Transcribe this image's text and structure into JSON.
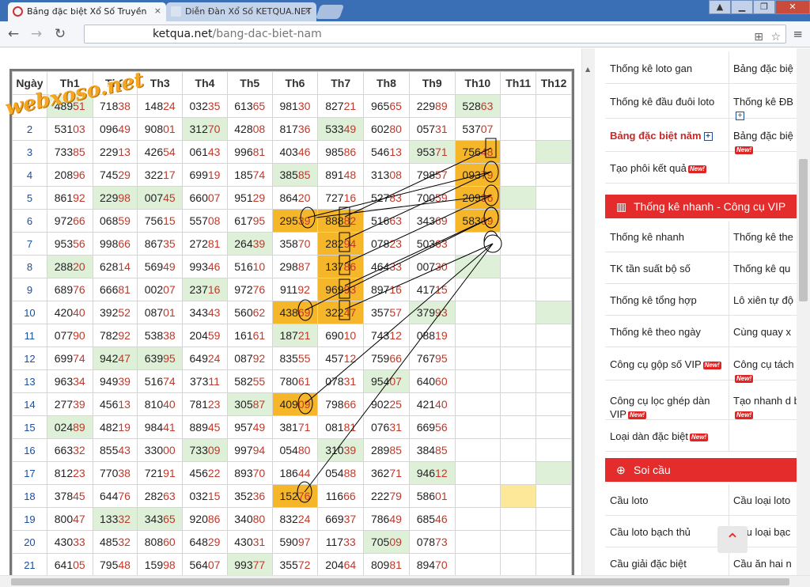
{
  "browser": {
    "tabs": [
      {
        "title": "Bảng đặc biệt Xổ Số Truyền",
        "active": true
      },
      {
        "title": "Diễn Đàn Xổ Số KETQUA.NET",
        "active": false
      }
    ],
    "url_host": "ketqua.net",
    "url_path": "/bang-dac-biet-nam",
    "close_glyph": "×"
  },
  "watermark": "webxoso.net",
  "table": {
    "headers": [
      "Ngày",
      "Th1",
      "Th2",
      "Th3",
      "Th4",
      "Th5",
      "Th6",
      "Th7",
      "Th8",
      "Th9",
      "Th10",
      "Th11",
      "Th12"
    ],
    "rows": [
      {
        "day": "1",
        "cells": [
          "48951",
          "71838",
          "14824",
          "03235",
          "61365",
          "98130",
          "82721",
          "96565",
          "22989",
          "52863",
          "",
          ""
        ],
        "hl": {
          "0": "g",
          "9": "g"
        }
      },
      {
        "day": "2",
        "cells": [
          "53103",
          "09649",
          "90801",
          "31270",
          "42808",
          "81736",
          "53349",
          "60280",
          "05731",
          "53707",
          "",
          ""
        ],
        "hl": {
          "3": "g",
          "6": "g"
        }
      },
      {
        "day": "3",
        "cells": [
          "73385",
          "22913",
          "42654",
          "06143",
          "99681",
          "40346",
          "98586",
          "54613",
          "95371",
          "75648",
          "",
          ""
        ],
        "hl": {
          "8": "g",
          "9": "o",
          "11": "g"
        }
      },
      {
        "day": "4",
        "cells": [
          "20896",
          "74529",
          "32217",
          "69919",
          "18574",
          "38585",
          "89148",
          "31308",
          "79857",
          "09379",
          "",
          ""
        ],
        "hl": {
          "5": "g",
          "9": "o"
        }
      },
      {
        "day": "5",
        "cells": [
          "86192",
          "22998",
          "00745",
          "66007",
          "95129",
          "86420",
          "72716",
          "52783",
          "70059",
          "20996",
          "",
          ""
        ],
        "hl": {
          "1": "g",
          "2": "g",
          "9": "o",
          "10": "g"
        }
      },
      {
        "day": "6",
        "cells": [
          "97266",
          "06859",
          "75615",
          "55708",
          "61795",
          "29539",
          "88882",
          "51663",
          "34369",
          "58309",
          "",
          ""
        ],
        "hl": {
          "5": "o",
          "6": "o",
          "9": "o"
        }
      },
      {
        "day": "7",
        "cells": [
          "95356",
          "99866",
          "86735",
          "27281",
          "26439",
          "35870",
          "28294",
          "07823",
          "50363",
          "",
          "",
          ""
        ],
        "hl": {
          "4": "g",
          "6": "o"
        }
      },
      {
        "day": "8",
        "cells": [
          "28820",
          "62814",
          "56949",
          "99346",
          "51610",
          "29887",
          "13786",
          "46433",
          "00730",
          "",
          "",
          ""
        ],
        "hl": {
          "0": "g",
          "6": "o",
          "9": "g"
        }
      },
      {
        "day": "9",
        "cells": [
          "68976",
          "66681",
          "00207",
          "23716",
          "97276",
          "91192",
          "96993",
          "89716",
          "41715",
          "",
          "",
          ""
        ],
        "hl": {
          "3": "g",
          "6": "o"
        }
      },
      {
        "day": "10",
        "cells": [
          "42040",
          "39252",
          "08701",
          "34343",
          "56062",
          "43869",
          "32247",
          "35757",
          "37993",
          "",
          "",
          ""
        ],
        "hl": {
          "5": "o",
          "6": "o",
          "8": "g",
          "11": "g"
        }
      },
      {
        "day": "11",
        "cells": [
          "07790",
          "78292",
          "53838",
          "20459",
          "16161",
          "18721",
          "69010",
          "74312",
          "08819",
          "",
          "",
          ""
        ],
        "hl": {
          "5": "g"
        }
      },
      {
        "day": "12",
        "cells": [
          "69974",
          "94247",
          "63995",
          "64924",
          "08792",
          "83555",
          "45712",
          "75966",
          "76795",
          "",
          "",
          ""
        ],
        "hl": {
          "1": "g",
          "2": "g"
        }
      },
      {
        "day": "13",
        "cells": [
          "96334",
          "94939",
          "51674",
          "37311",
          "58255",
          "78061",
          "07831",
          "95407",
          "64060",
          "",
          "",
          ""
        ],
        "hl": {
          "7": "g"
        }
      },
      {
        "day": "14",
        "cells": [
          "27739",
          "45613",
          "81040",
          "78123",
          "30587",
          "40909",
          "79866",
          "90225",
          "42140",
          "",
          "",
          ""
        ],
        "hl": {
          "4": "g",
          "5": "o"
        }
      },
      {
        "day": "15",
        "cells": [
          "02489",
          "48219",
          "98441",
          "88945",
          "95749",
          "38171",
          "08181",
          "07631",
          "66956",
          "",
          "",
          ""
        ],
        "hl": {
          "0": "g"
        }
      },
      {
        "day": "16",
        "cells": [
          "66332",
          "85543",
          "33000",
          "73309",
          "99794",
          "05480",
          "31039",
          "28985",
          "38485",
          "",
          "",
          ""
        ],
        "hl": {
          "3": "g",
          "6": "g"
        }
      },
      {
        "day": "17",
        "cells": [
          "81223",
          "77038",
          "72191",
          "45622",
          "89370",
          "18644",
          "05488",
          "36271",
          "94612",
          "",
          "",
          ""
        ],
        "hl": {
          "8": "g",
          "11": "g"
        }
      },
      {
        "day": "18",
        "cells": [
          "37845",
          "64476",
          "28263",
          "03215",
          "35236",
          "15276",
          "11666",
          "22279",
          "58601",
          "",
          "",
          ""
        ],
        "hl": {
          "5": "o",
          "10": "y"
        }
      },
      {
        "day": "19",
        "cells": [
          "80047",
          "13332",
          "34365",
          "92086",
          "34080",
          "83224",
          "66937",
          "78649",
          "68546",
          "",
          "",
          ""
        ],
        "hl": {
          "1": "g",
          "2": "g"
        }
      },
      {
        "day": "20",
        "cells": [
          "43033",
          "48532",
          "80860",
          "64829",
          "43031",
          "59097",
          "11733",
          "70509",
          "07873",
          "",
          "",
          ""
        ],
        "hl": {
          "7": "g"
        }
      },
      {
        "day": "21",
        "cells": [
          "64105",
          "79548",
          "15998",
          "56407",
          "99377",
          "35572",
          "20464",
          "80981",
          "89470",
          "",
          "",
          ""
        ],
        "hl": {
          "4": "g"
        }
      }
    ]
  },
  "sidebar": {
    "top_rows": [
      {
        "left": "Thống kê loto gan",
        "right": "Bảng đặc biệ"
      },
      {
        "left": "Thống kê đầu đuôi loto",
        "right": "Thống kê ĐB",
        "right_plus": true
      },
      {
        "left": "Bảng đặc biệt năm",
        "left_plus": true,
        "left_hot": true,
        "right": "Bảng đặc biệ",
        "right_new": true
      },
      {
        "left": "Tạo phôi kết quả",
        "left_new": true,
        "right": ""
      }
    ],
    "section1": {
      "title": "Thống kê nhanh - Công cụ VIP",
      "icon": "bar-chart-icon"
    },
    "section1_rows": [
      {
        "left": "Thống kê nhanh",
        "right": "Thống kê the"
      },
      {
        "left": "TK tần suất bộ số",
        "right": "Thống kê qu"
      },
      {
        "left": "Thống kê tổng hợp",
        "right": "Lô xiên tự độ"
      },
      {
        "left": "Thống kê theo ngày",
        "right": "Cùng quay x"
      },
      {
        "left": "Công cụ gộp số VIP",
        "left_new": true,
        "right": "Công cụ tách",
        "right_new": true
      },
      {
        "left": "Công cụ lọc ghép dàn VIP",
        "left_new": true,
        "right": "Tạo nhanh d biệt",
        "right_new": true
      },
      {
        "left": "Loại dàn đặc biệt",
        "left_new": true,
        "right": ""
      }
    ],
    "section2": {
      "title": "Soi cầu",
      "icon": "search-plus-icon"
    },
    "section2_rows": [
      {
        "left": "Cầu loto",
        "right": "Cầu loại loto"
      },
      {
        "left": "Cầu loto bạch thủ",
        "right": "Cầu loại bạc"
      },
      {
        "left": "Cầu giải đặc biệt",
        "right": "Cầu ăn hai n"
      }
    ],
    "new_label": "New!"
  },
  "colors": {
    "green": "#dff0d8",
    "orange": "#f6b62a",
    "yellow": "#fde89a",
    "red": "#e42c2c",
    "day_blue": "#1a4fa0"
  }
}
